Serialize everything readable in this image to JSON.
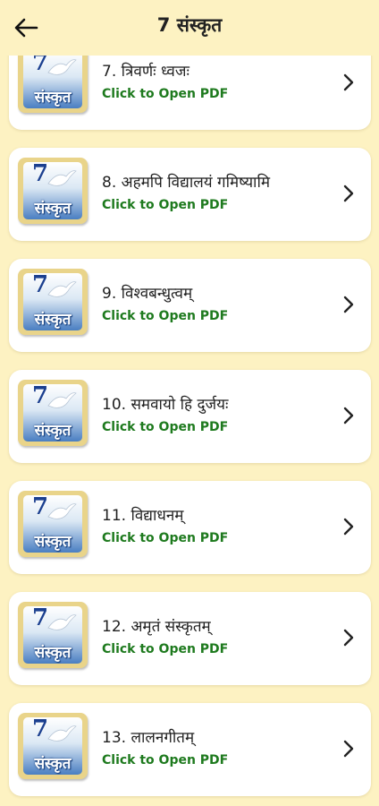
{
  "header": {
    "title": "7 संस्कृत",
    "back_icon": "arrow-left-icon"
  },
  "thumbnail": {
    "number": "7",
    "word": "संस्कृत"
  },
  "chapters": [
    {
      "title": "7. त्रिवर्णः ध्वजः",
      "subtitle": "Click to Open PDF"
    },
    {
      "title": "8. अहमपि विद्यालयं गमिष्यामि",
      "subtitle": "Click to Open PDF"
    },
    {
      "title": "9. विश्वबन्धुत्वम्",
      "subtitle": "Click to Open PDF"
    },
    {
      "title": "10. समवायो हि दुर्जयः",
      "subtitle": "Click to Open PDF"
    },
    {
      "title": "11. विद्याधनम्",
      "subtitle": "Click to Open PDF"
    },
    {
      "title": "12. अमृतं संस्कृतम्",
      "subtitle": "Click to Open PDF"
    },
    {
      "title": "13. लालनगीतम्",
      "subtitle": "Click to Open PDF"
    }
  ],
  "colors": {
    "background": "#fdf2c2",
    "subtitle": "#1e7a1e",
    "card": "#ffffff"
  }
}
